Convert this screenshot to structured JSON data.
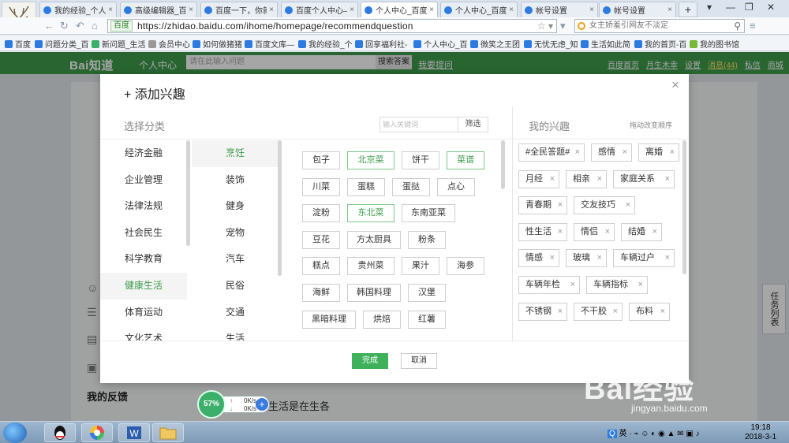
{
  "browser": {
    "tabs": [
      {
        "title": "我的经验_个人中"
      },
      {
        "title": "高级编辑器_百度"
      },
      {
        "title": "百度一下，你就"
      },
      {
        "title": "百度个人中心—"
      },
      {
        "title": "个人中心_百度知"
      },
      {
        "title": "个人中心_百度知"
      },
      {
        "title": "帐号设置"
      },
      {
        "title": "帐号设置"
      }
    ],
    "active_tab": 4,
    "url_badge": "百度",
    "url": "https://zhidao.baidu.com/ihome/homepage/recommendquestion",
    "search_placeholder": "女主娇羞引网友不淡定",
    "bookmarks": [
      "百度",
      "问题分类_百",
      "新问题_生活",
      "会员中心",
      "如何做猪猪",
      "百度文库—",
      "我的经验_个",
      "回享福利社-",
      "个人中心_百",
      "微笑之王团",
      "无忧无虑_知",
      "生活如此简",
      "我的首页-百",
      "我的图书馆"
    ]
  },
  "zhidao_header": {
    "logo": "Bai知道",
    "section": "个人中心",
    "search_placeholder": "请在此输入问题",
    "search_button": "搜索答案",
    "ask_link": "我要提问",
    "links": [
      "百度首页",
      "月生木幸",
      "设置",
      "消息(44)",
      "私信",
      "商城"
    ]
  },
  "background_page": {
    "my_feedback": "我的反馈",
    "behind_text": "生活是在生各",
    "side_tab": "任务列表"
  },
  "dialog": {
    "title": "+ 添加兴趣",
    "close": "×",
    "choose_label": "选择分类",
    "keyword_placeholder": "输入关键词",
    "filter_button": "筛选",
    "my_interests_label": "我的兴趣",
    "drag_hint": "拖动改变顺序",
    "categories": [
      "经济金融",
      "企业管理",
      "法律法规",
      "社会民生",
      "科学教育",
      "健康生活",
      "体育运动",
      "文化艺术"
    ],
    "active_category": 5,
    "subcategories": [
      "烹饪",
      "装饰",
      "健身",
      "宠物",
      "汽车",
      "民俗",
      "交通",
      "生活"
    ],
    "active_subcategory": 0,
    "tag_rows": [
      [
        {
          "label": "包子",
          "selected": false
        },
        {
          "label": "北京菜",
          "selected": true
        },
        {
          "label": "饼干",
          "selected": false
        },
        {
          "label": "菜谱",
          "selected": true
        }
      ],
      [
        {
          "label": "川菜",
          "selected": false
        },
        {
          "label": "蛋糕",
          "selected": false
        },
        {
          "label": "蛋挞",
          "selected": false
        },
        {
          "label": "点心",
          "selected": false
        }
      ],
      [
        {
          "label": "淀粉",
          "selected": false
        },
        {
          "label": "东北菜",
          "selected": true
        },
        {
          "label": "东南亚菜",
          "selected": false
        }
      ],
      [
        {
          "label": "豆花",
          "selected": false
        },
        {
          "label": "方太厨具",
          "selected": false
        },
        {
          "label": "粉条",
          "selected": false
        }
      ],
      [
        {
          "label": "糕点",
          "selected": false
        },
        {
          "label": "贵州菜",
          "selected": false
        },
        {
          "label": "果汁",
          "selected": false
        },
        {
          "label": "海参",
          "selected": false
        }
      ],
      [
        {
          "label": "海鲜",
          "selected": false
        },
        {
          "label": "韩国料理",
          "selected": false
        },
        {
          "label": "汉堡",
          "selected": false
        }
      ],
      [
        {
          "label": "黑暗料理",
          "selected": false
        },
        {
          "label": "烘焙",
          "selected": false
        },
        {
          "label": "红薯",
          "selected": false
        }
      ]
    ],
    "my_interest_rows": [
      [
        "#全民答题#",
        "感情",
        "离婚"
      ],
      [
        "月经",
        "相亲",
        "家庭关系"
      ],
      [
        "青春期",
        "交友技巧"
      ],
      [
        "性生活",
        "情侣",
        "结婚"
      ],
      [
        "情感",
        "玻璃",
        "车辆过户"
      ],
      [
        "车辆年检",
        "车辆指标"
      ],
      [
        "不锈钢",
        "不干胶",
        "布料"
      ]
    ],
    "remove_symbol": "×",
    "done_button": "完成",
    "cancel_button": "取消"
  },
  "speed_widget": {
    "percent": "57%",
    "up": "0K/s",
    "down": "0K/s"
  },
  "watermark": {
    "main": "Bai经验",
    "sub": "jingyan.baidu.com"
  },
  "taskbar": {
    "apps": [
      "腾讯QQ",
      "彩虹",
      "Word",
      "文件夹"
    ],
    "tray_lang": "英",
    "time": "19:18",
    "date": "2018-3-1"
  }
}
